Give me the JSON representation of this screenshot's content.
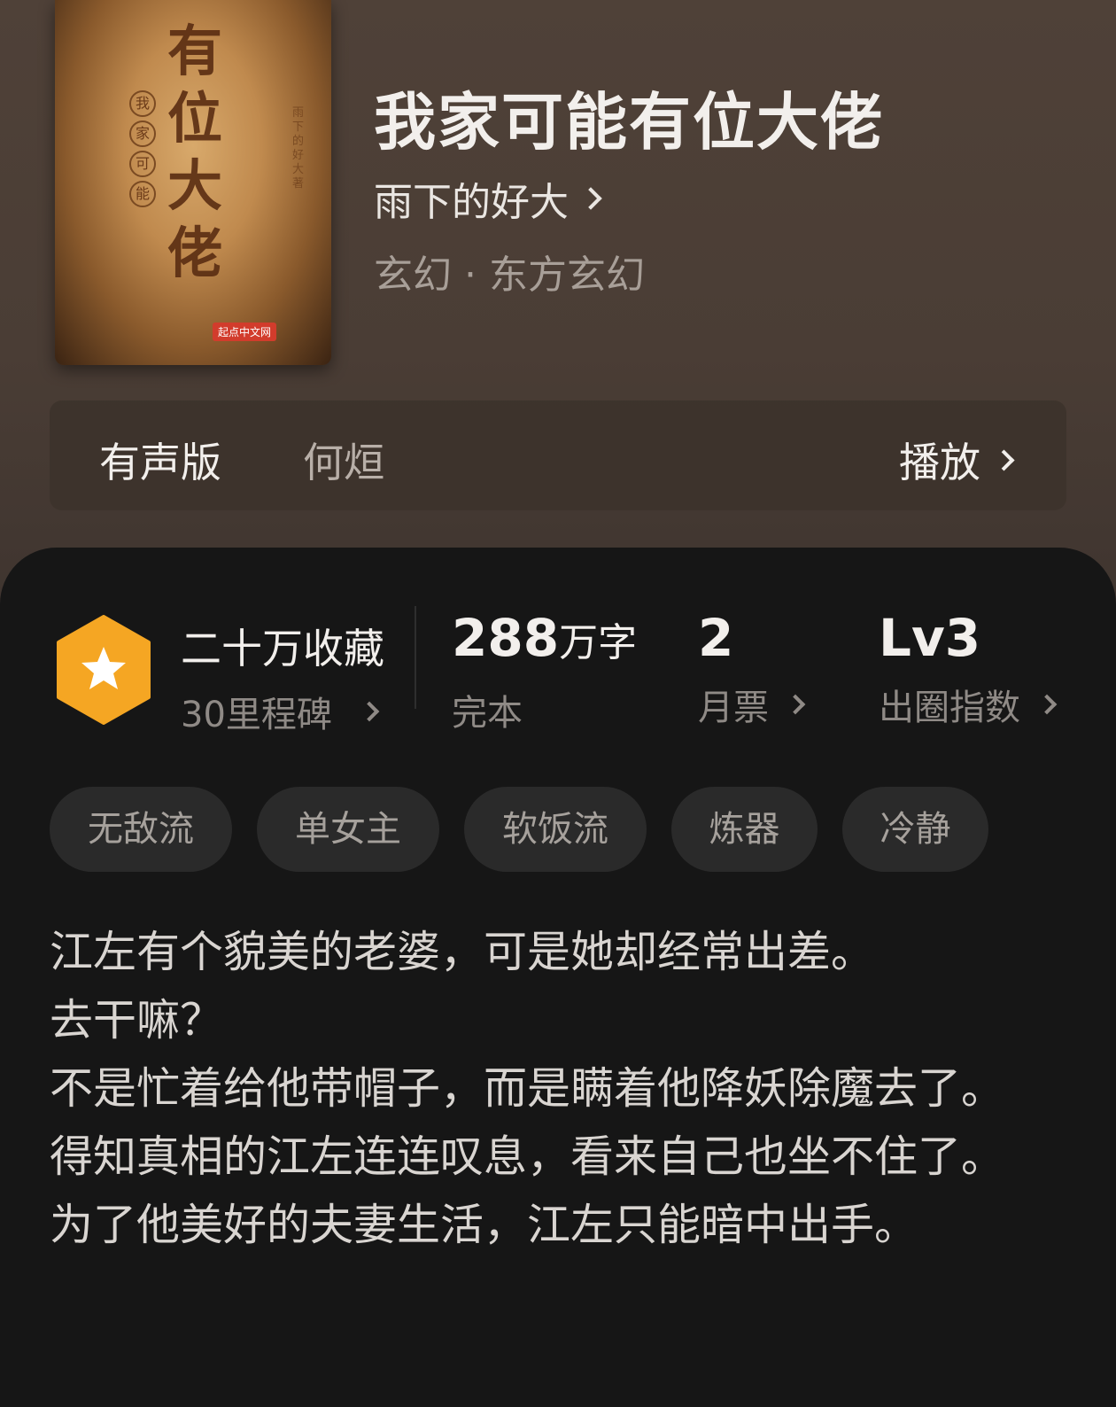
{
  "book": {
    "cover_title": "有位大佬",
    "cover_subtitle": [
      "我",
      "家",
      "可",
      "能"
    ],
    "cover_author": "雨下的好大著",
    "cover_publisher": "起点中文网",
    "title": "我家可能有位大佬",
    "author": "雨下的好大",
    "genre": "玄幻 · 东方玄幻"
  },
  "audio": {
    "label": "有声版",
    "narrator": "何烜",
    "play_label": "播放"
  },
  "stats": {
    "collect_main": "二十万收藏",
    "collect_sub": "30里程碑",
    "words_num": "288",
    "words_unit": "万字",
    "words_label": "完本",
    "monthly_num": "2",
    "monthly_label": "月票",
    "index_num": "Lv3",
    "index_label": "出圈指数"
  },
  "tags": [
    "无敌流",
    "单女主",
    "软饭流",
    "炼器",
    "冷静"
  ],
  "synopsis": [
    "江左有个貌美的老婆，可是她却经常出差。",
    "去干嘛？",
    "不是忙着给他带帽子，而是瞒着他降妖除魔去了。",
    "得知真相的江左连连叹息，看来自己也坐不住了。",
    "为了他美好的夫妻生活，江左只能暗中出手。"
  ],
  "colors": {
    "badge": "#f5a623",
    "panel": "#161616",
    "header": "#4f4138"
  }
}
